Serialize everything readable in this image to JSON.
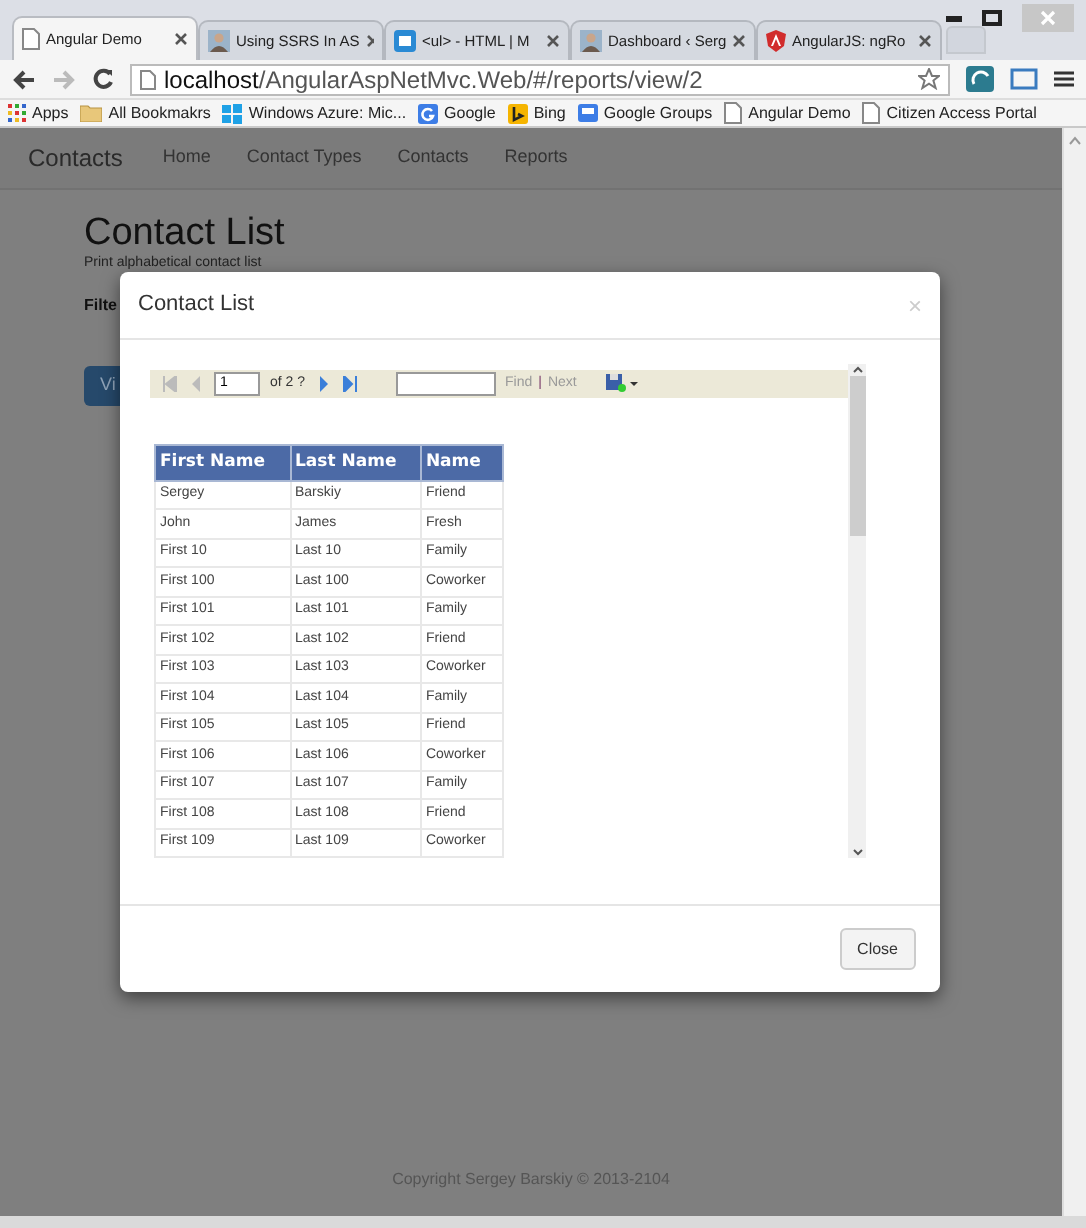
{
  "browser": {
    "tabs": [
      {
        "title": "Angular Demo",
        "selected": true,
        "kind": "page"
      },
      {
        "title": "Using SSRS In AS",
        "selected": false,
        "kind": "avatar"
      },
      {
        "title": "<ul> - HTML | M",
        "selected": false,
        "kind": "doc"
      },
      {
        "title": "Dashboard ‹ Serg",
        "selected": false,
        "kind": "avatar"
      },
      {
        "title": "AngularJS: ngRo",
        "selected": false,
        "kind": "shield"
      }
    ],
    "address": {
      "host": "localhost",
      "path": "/AngularAspNetMvc.Web/#/reports/view/2"
    },
    "bookmarks": [
      {
        "label": "Apps",
        "kind": "apps"
      },
      {
        "label": "All Bookmakrs",
        "kind": "folder"
      },
      {
        "label": "Windows Azure: Mic...",
        "kind": "windows"
      },
      {
        "label": "Google",
        "kind": "g"
      },
      {
        "label": "Bing",
        "kind": "b"
      },
      {
        "label": "Google Groups",
        "kind": "groups"
      },
      {
        "label": "Angular Demo",
        "kind": "page"
      },
      {
        "label": "Citizen Access Portal",
        "kind": "page"
      }
    ]
  },
  "navbar": {
    "brand": "Contacts",
    "links": [
      "Home",
      "Contact Types",
      "Contacts",
      "Reports"
    ]
  },
  "page": {
    "title": "Contact List",
    "subtitle": "Print alphabetical contact list",
    "filter_label": "Filte",
    "view_button": "Vi",
    "footer": "Copyright Sergey Barskiy © 2013-2104"
  },
  "modal": {
    "title": "Contact List",
    "close_symbol": "×",
    "report_toolbar": {
      "page": "1",
      "of_pages": "of 2 ?",
      "find": "Find",
      "separator": "|",
      "next": "Next"
    },
    "table": {
      "columns": [
        "First Name",
        "Last Name",
        "Name"
      ],
      "rows": [
        [
          "Sergey",
          "Barskiy",
          "Friend"
        ],
        [
          "John",
          "James",
          "Fresh"
        ],
        [
          "First 10",
          "Last 10",
          "Family"
        ],
        [
          "First 100",
          "Last 100",
          "Coworker"
        ],
        [
          "First 101",
          "Last 101",
          "Family"
        ],
        [
          "First 102",
          "Last 102",
          "Friend"
        ],
        [
          "First 103",
          "Last 103",
          "Coworker"
        ],
        [
          "First 104",
          "Last 104",
          "Family"
        ],
        [
          "First 105",
          "Last 105",
          "Friend"
        ],
        [
          "First 106",
          "Last 106",
          "Coworker"
        ],
        [
          "First 107",
          "Last 107",
          "Family"
        ],
        [
          "First 108",
          "Last 108",
          "Friend"
        ],
        [
          "First 109",
          "Last 109",
          "Coworker"
        ]
      ]
    },
    "close_button": "Close"
  }
}
